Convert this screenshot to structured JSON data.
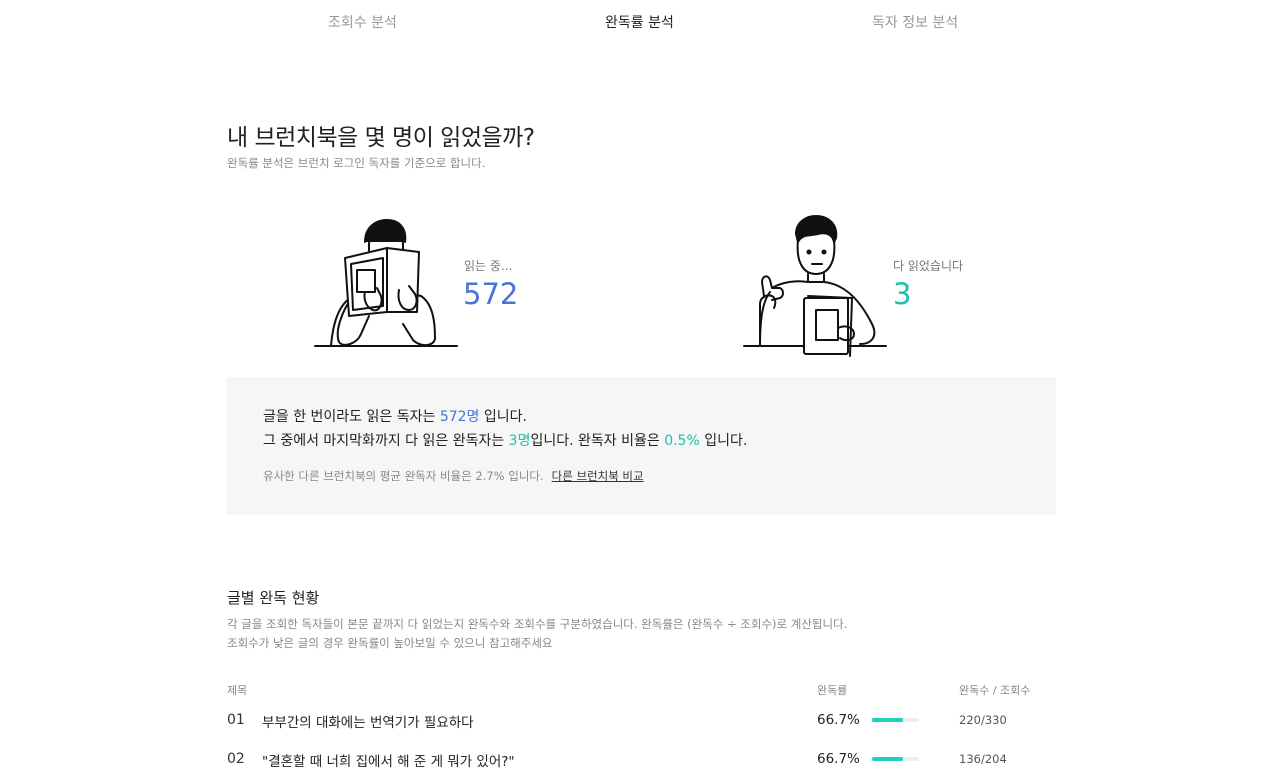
{
  "tabs": [
    {
      "label": "조회수 분석",
      "active": false
    },
    {
      "label": "완독률 분석",
      "active": true
    },
    {
      "label": "독자 정보 분석",
      "active": false
    }
  ],
  "headline": "내 브런치북을 몇 명이 읽었을까?",
  "subline": "완독률 분석은 브런치 로그인 독자를 기준으로 합니다.",
  "stats": {
    "reading": {
      "label": "읽는 중...",
      "value": "572",
      "icon": "reading-person-illustration"
    },
    "done": {
      "label": "다 읽었습니다",
      "value": "3",
      "icon": "thumbs-up-person-illustration"
    }
  },
  "summary": {
    "line1_prefix": "글을 한 번이라도 읽은 독자는 ",
    "line1_value": "572명",
    "line1_suffix": " 입니다.",
    "line2_prefix": "그 중에서 마지막화까지 다 읽은 완독자는 ",
    "line2_value": "3명",
    "line2_mid": "입니다. 완독자 비율은 ",
    "line2_ratio": "0.5%",
    "line2_suffix": " 입니다.",
    "note": "유사한 다른 브런치북의 평균 완독자 비율은 2.7% 입니다.",
    "link": "다른 브런치북 비교"
  },
  "section": {
    "title": "글별 완독 현황",
    "desc1": "각 글을 조회한 독자들이 본문 끝까지 다 읽었는지 완독수와 조회수를 구분하였습니다. 완독률은 (완독수 ÷ 조회수)로 계산됩니다.",
    "desc2": "조회수가 낮은 글의 경우 완독률이 높아보일 수 있으니 참고해주세요"
  },
  "table": {
    "headers": {
      "title": "제목",
      "rate": "완독률",
      "count": "완독수 / 조회수"
    },
    "rows": [
      {
        "num": "01",
        "title": "부부간의 대화에는 번역기가 필요하다",
        "rate": "66.7%",
        "rate_value": 0.667,
        "count": "220/330"
      },
      {
        "num": "02",
        "title": "\"결혼할 때 너희 집에서 해 준 게 뭐가 있어?\"",
        "rate": "66.7%",
        "rate_value": 0.667,
        "count": "136/204"
      }
    ]
  },
  "colors": {
    "blue": "#4a72d9",
    "teal": "#1fbfaf",
    "bar": "#1fcfbf"
  }
}
